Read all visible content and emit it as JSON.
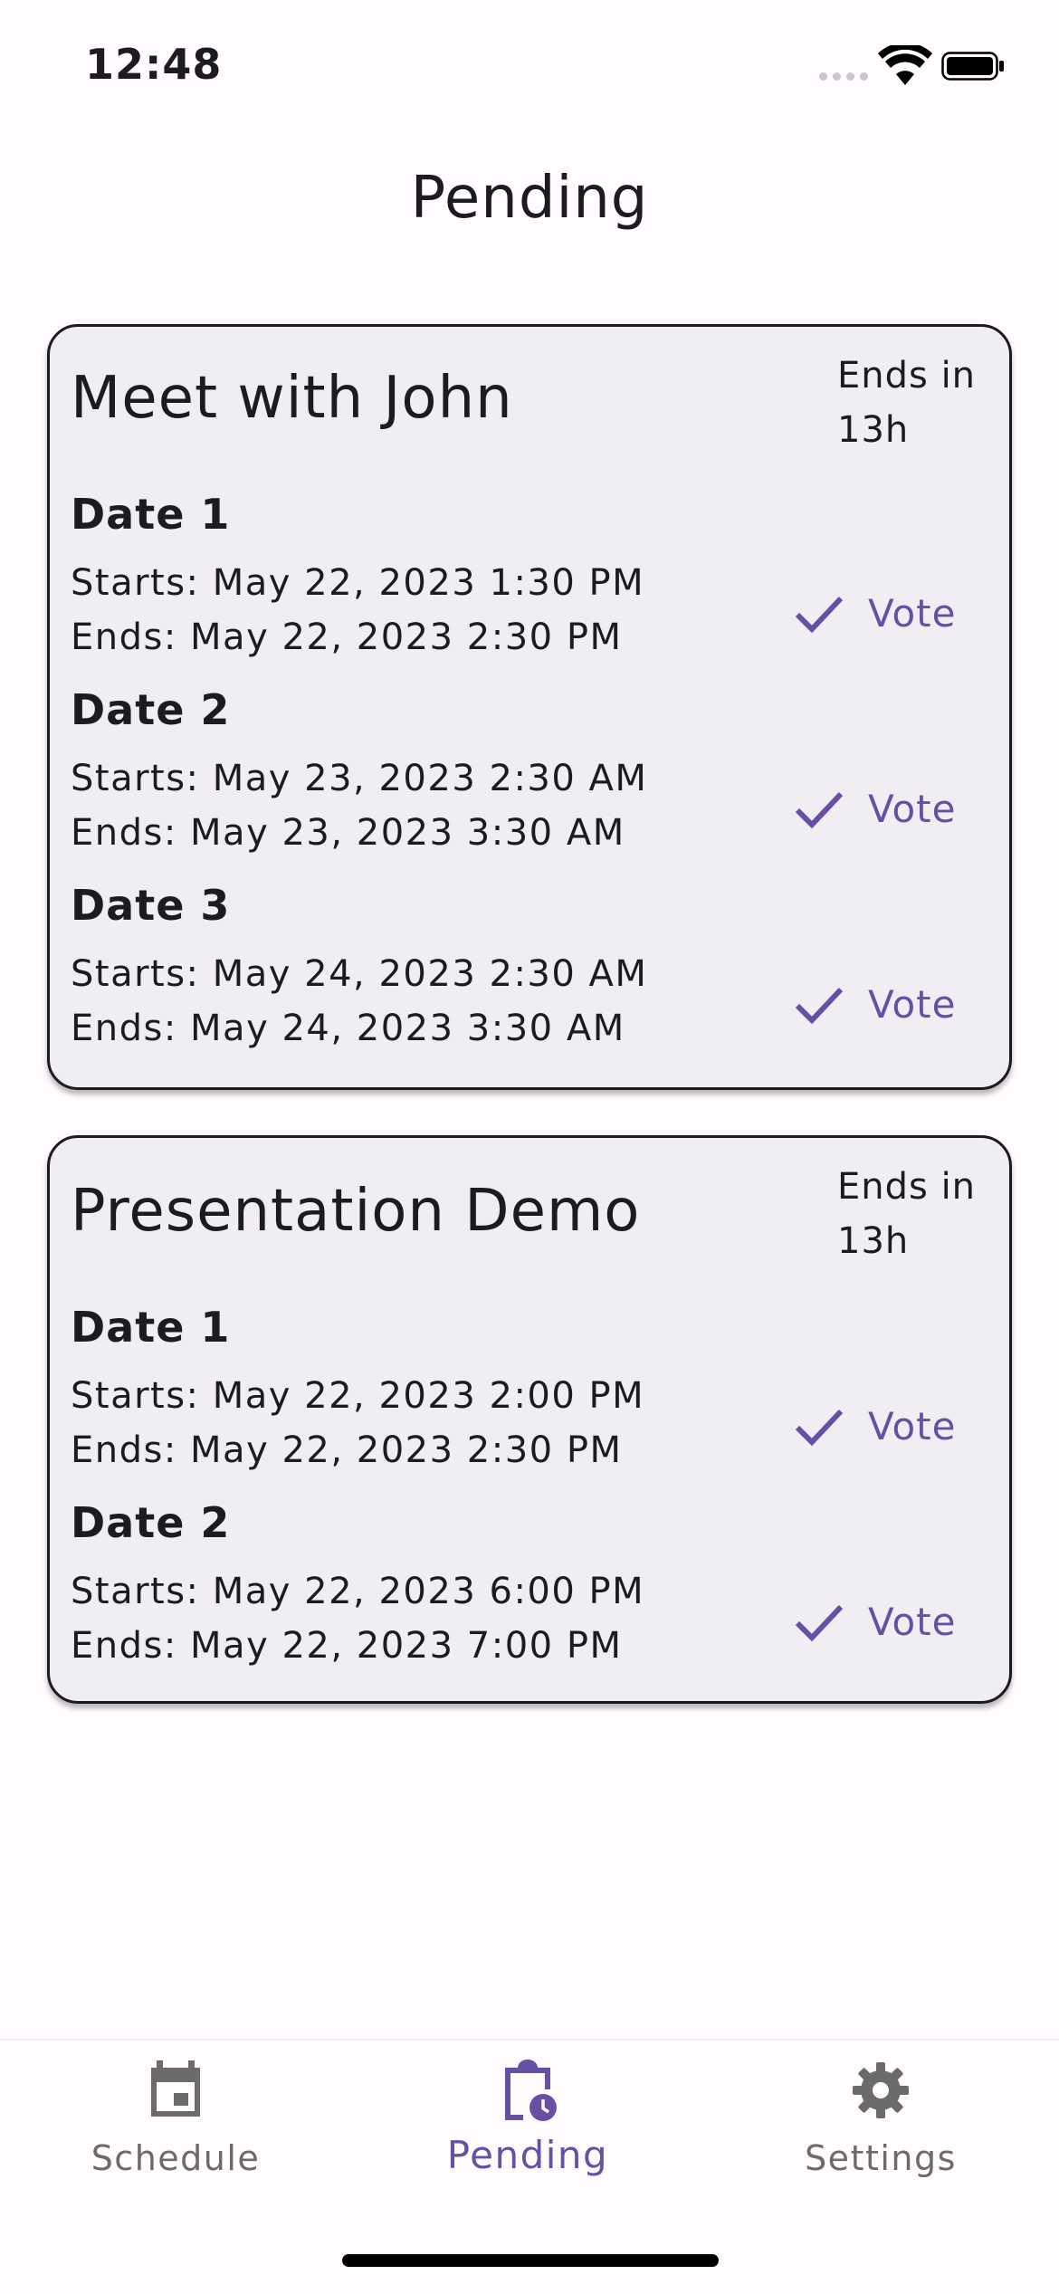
{
  "status_bar": {
    "time": "12:48"
  },
  "page": {
    "title": "Pending"
  },
  "cards": [
    {
      "title": "Meet with John",
      "ends_in": "Ends in 13h",
      "dates": [
        {
          "label": "Date 1",
          "starts": "Starts: May 22, 2023 1:30 PM",
          "ends": "Ends: May 22, 2023 2:30 PM",
          "action": "Vote"
        },
        {
          "label": "Date 2",
          "starts": "Starts: May 23, 2023 2:30 AM",
          "ends": "Ends: May 23, 2023 3:30 AM",
          "action": "Vote"
        },
        {
          "label": "Date 3",
          "starts": "Starts: May 24, 2023 2:30 AM",
          "ends": "Ends: May 24, 2023 3:30 AM",
          "action": "Vote"
        }
      ]
    },
    {
      "title": "Presentation Demo",
      "ends_in": "Ends in 13h",
      "dates": [
        {
          "label": "Date 1",
          "starts": "Starts: May 22, 2023 2:00 PM",
          "ends": "Ends: May 22, 2023 2:30 PM",
          "action": "Vote"
        },
        {
          "label": "Date 2",
          "starts": "Starts: May 22, 2023 6:00 PM",
          "ends": "Ends: May 22, 2023 7:00 PM",
          "action": "Vote"
        }
      ]
    }
  ],
  "nav": {
    "items": [
      {
        "label": "Schedule",
        "icon": "calendar-icon",
        "active": false
      },
      {
        "label": "Pending",
        "icon": "pending-clipboard-icon",
        "active": true
      },
      {
        "label": "Settings",
        "icon": "gear-icon",
        "active": false
      }
    ]
  },
  "colors": {
    "accent": "#6750a4",
    "card_bg": "#f0edf3",
    "page_bg": "#fffbfe",
    "muted": "#6b6b6b"
  }
}
